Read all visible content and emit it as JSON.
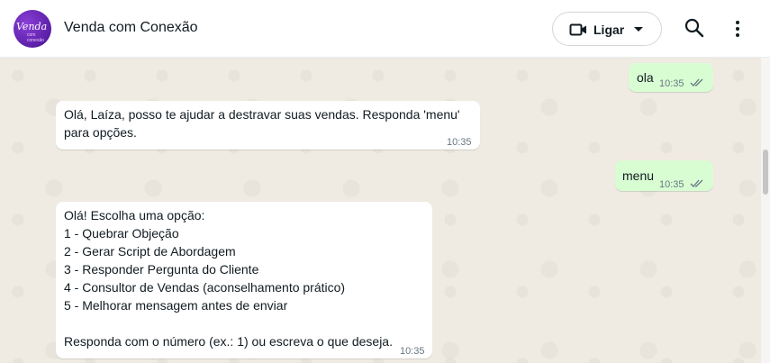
{
  "header": {
    "avatar_text_main": "Venda",
    "avatar_text_sub": "com conexão",
    "contact_name": "Venda com Conexão",
    "call_label": "Ligar",
    "icons": [
      "video-icon",
      "chevron-down-icon",
      "search-icon",
      "more-vertical-icon"
    ]
  },
  "messages": [
    {
      "direction": "out",
      "text": "ola",
      "time": "10:35",
      "status": "read"
    },
    {
      "direction": "in",
      "lines": [
        "Olá, Laíza, posso te ajudar a destravar suas vendas. Responda 'menu'",
        "para opções."
      ],
      "time": "10:35"
    },
    {
      "direction": "out",
      "text": "menu",
      "time": "10:35",
      "status": "read"
    },
    {
      "direction": "in",
      "lines": [
        "Olá! Escolha uma opção:",
        "1 - Quebrar Objeção",
        "2 - Gerar Script de Abordagem",
        "3 - Responder Pergunta do Cliente",
        "4 - Consultor de Vendas (aconselhamento prático)",
        "5 - Melhorar mensagem antes de enviar",
        "",
        "Responda com o número (ex.: 1) ou escreva o que deseja."
      ],
      "time": "10:35"
    }
  ],
  "colors": {
    "incoming": "#ffffff",
    "outgoing": "#d9fdd3",
    "wallpaper": "#efeae2"
  }
}
